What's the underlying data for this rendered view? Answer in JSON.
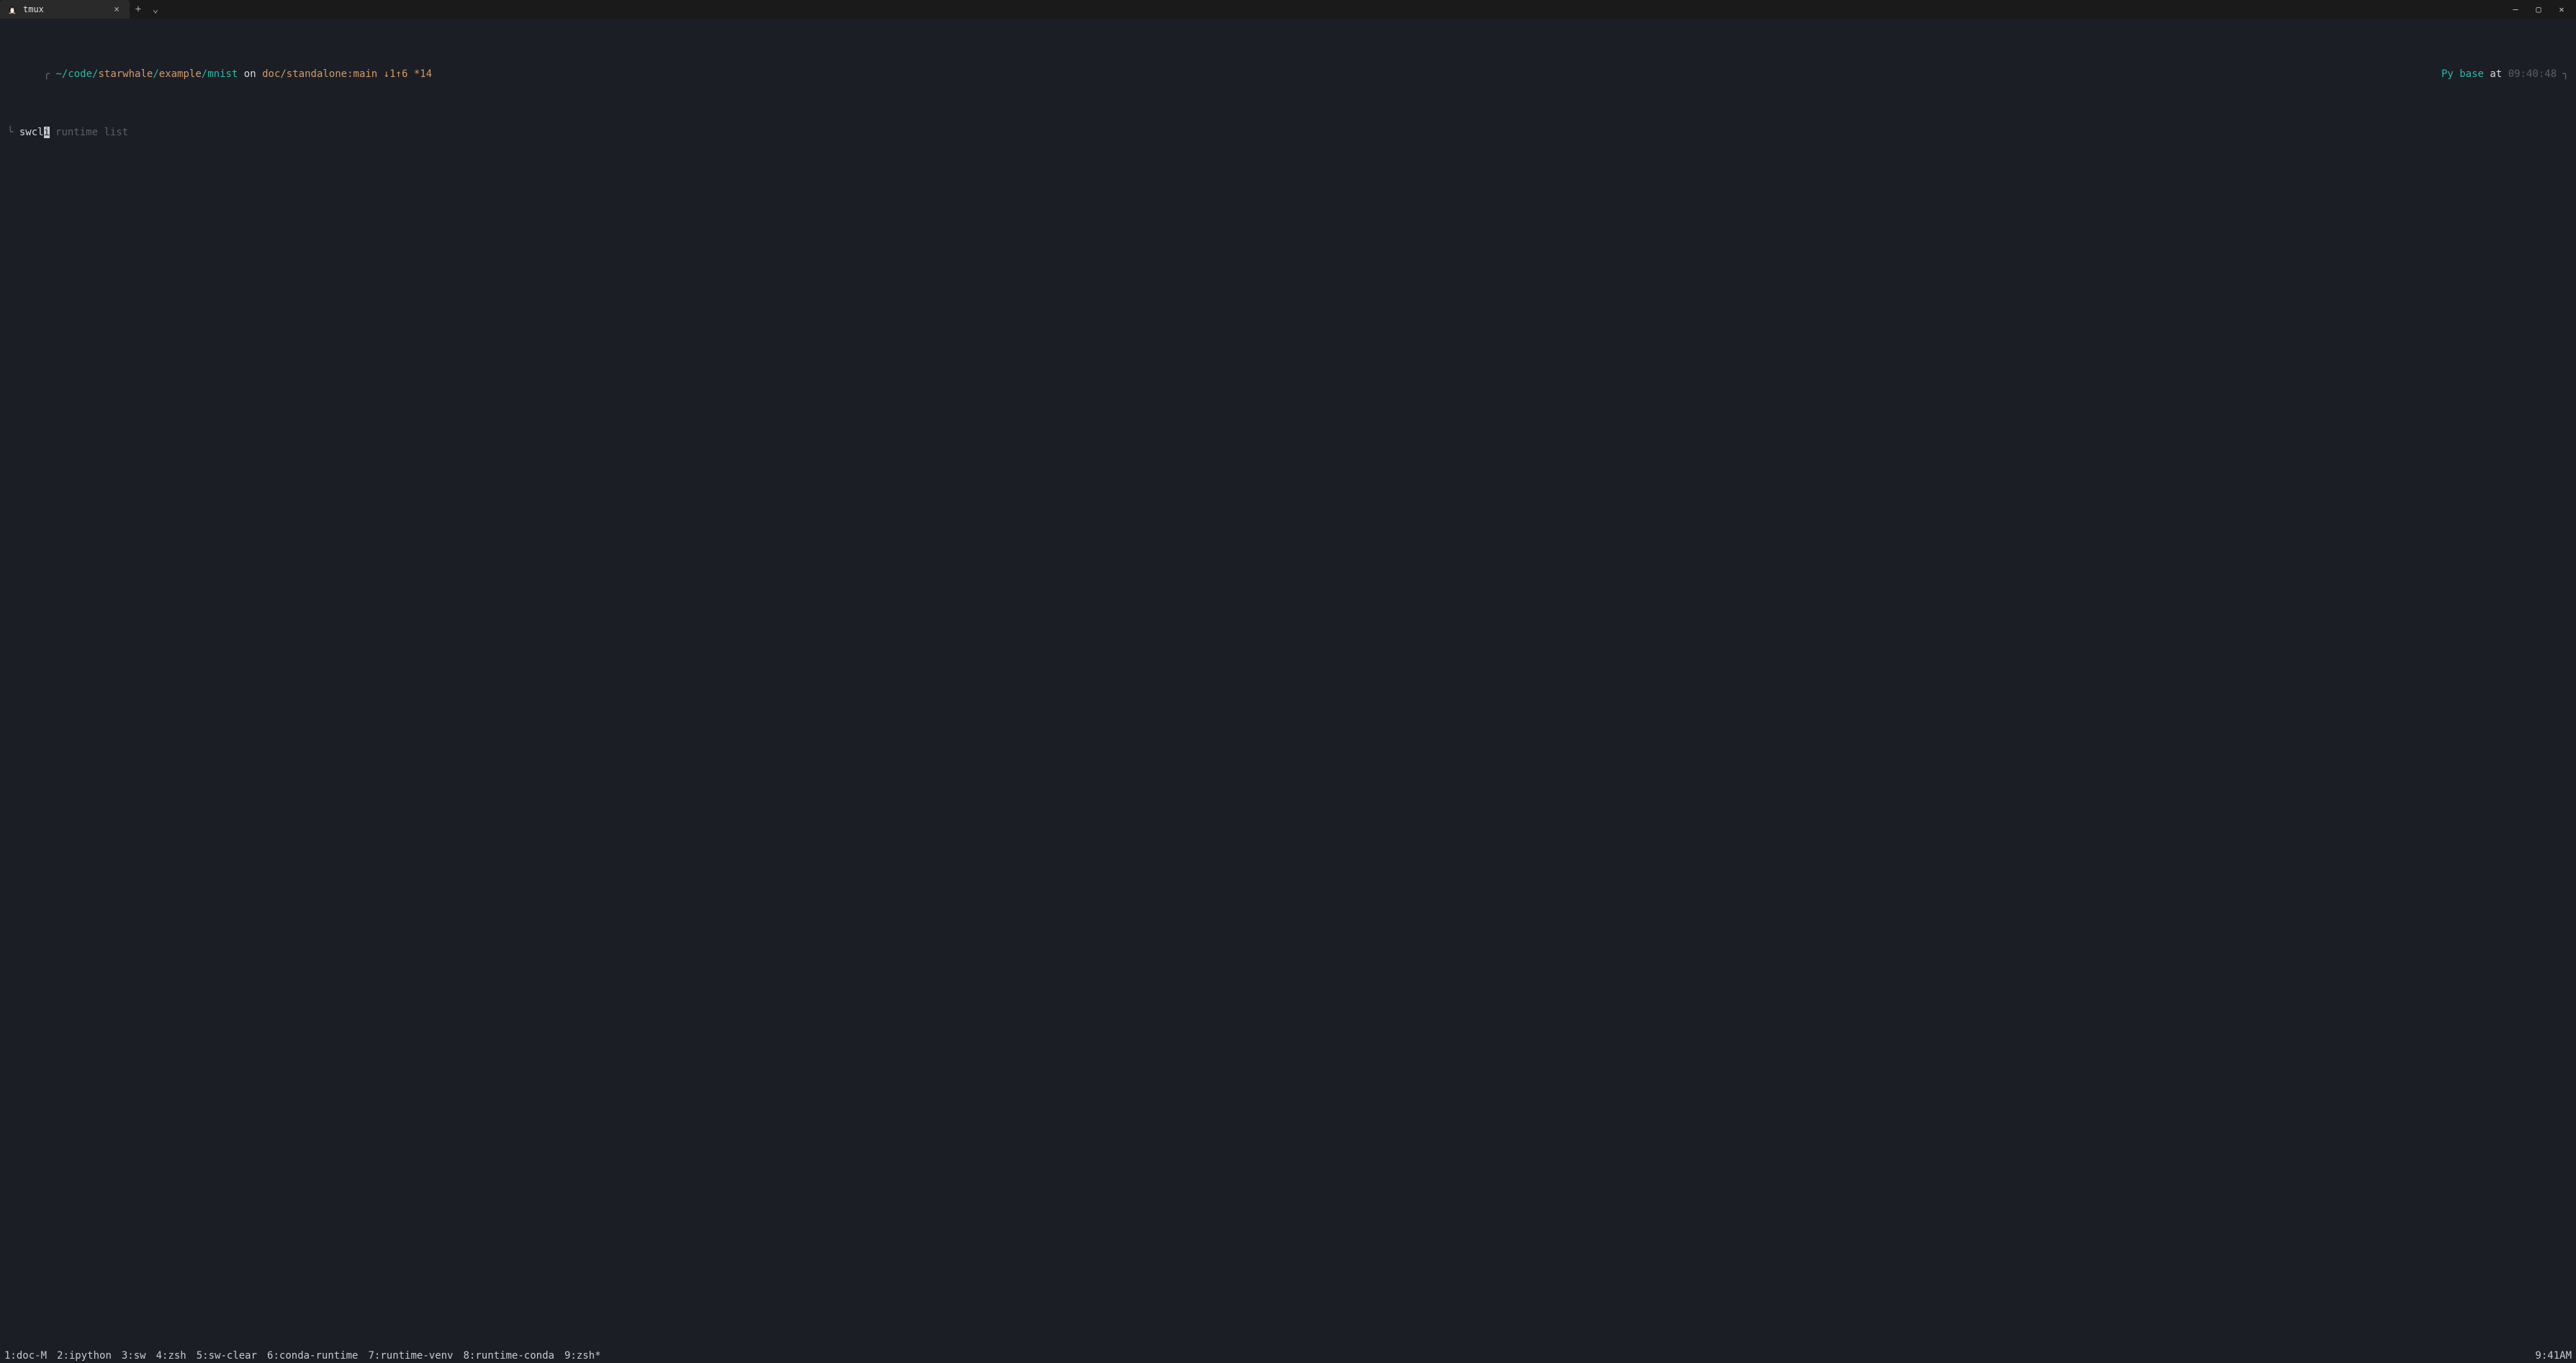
{
  "titlebar": {
    "tab_title": "tmux",
    "close_glyph": "×",
    "new_glyph": "+",
    "dropdown_glyph": "⌄",
    "min_glyph": "—",
    "max_glyph": "▢",
    "close_win_glyph": "✕"
  },
  "prompt": {
    "corner_tl": "╭",
    "corner_tr": "╮",
    "path": {
      "prefix": "~/code/",
      "repo": "starwhale",
      "sep1": "/",
      "sub1": "example",
      "sep2": "/",
      "sub2": "mnist"
    },
    "on": " on ",
    "branch": "doc/standalone:main",
    "gitstat": " ↓1↑6 *14",
    "right": {
      "py": "Py",
      "env": " base ",
      "at": "at",
      "time": " 09:40:48"
    },
    "corner_bl": "╰",
    "corner_br": "╯",
    "symbol": "❯",
    "typed": "swcl",
    "cursor_char": "i",
    "suggestion": " runtime list"
  },
  "statusbar": {
    "windows": [
      "1:doc-M",
      "2:ipython",
      "3:sw",
      "4:zsh",
      "5:sw-clear",
      "6:conda-runtime",
      "7:runtime-venv",
      "8:runtime-conda",
      "9:zsh*"
    ],
    "clock": "9:41AM"
  }
}
